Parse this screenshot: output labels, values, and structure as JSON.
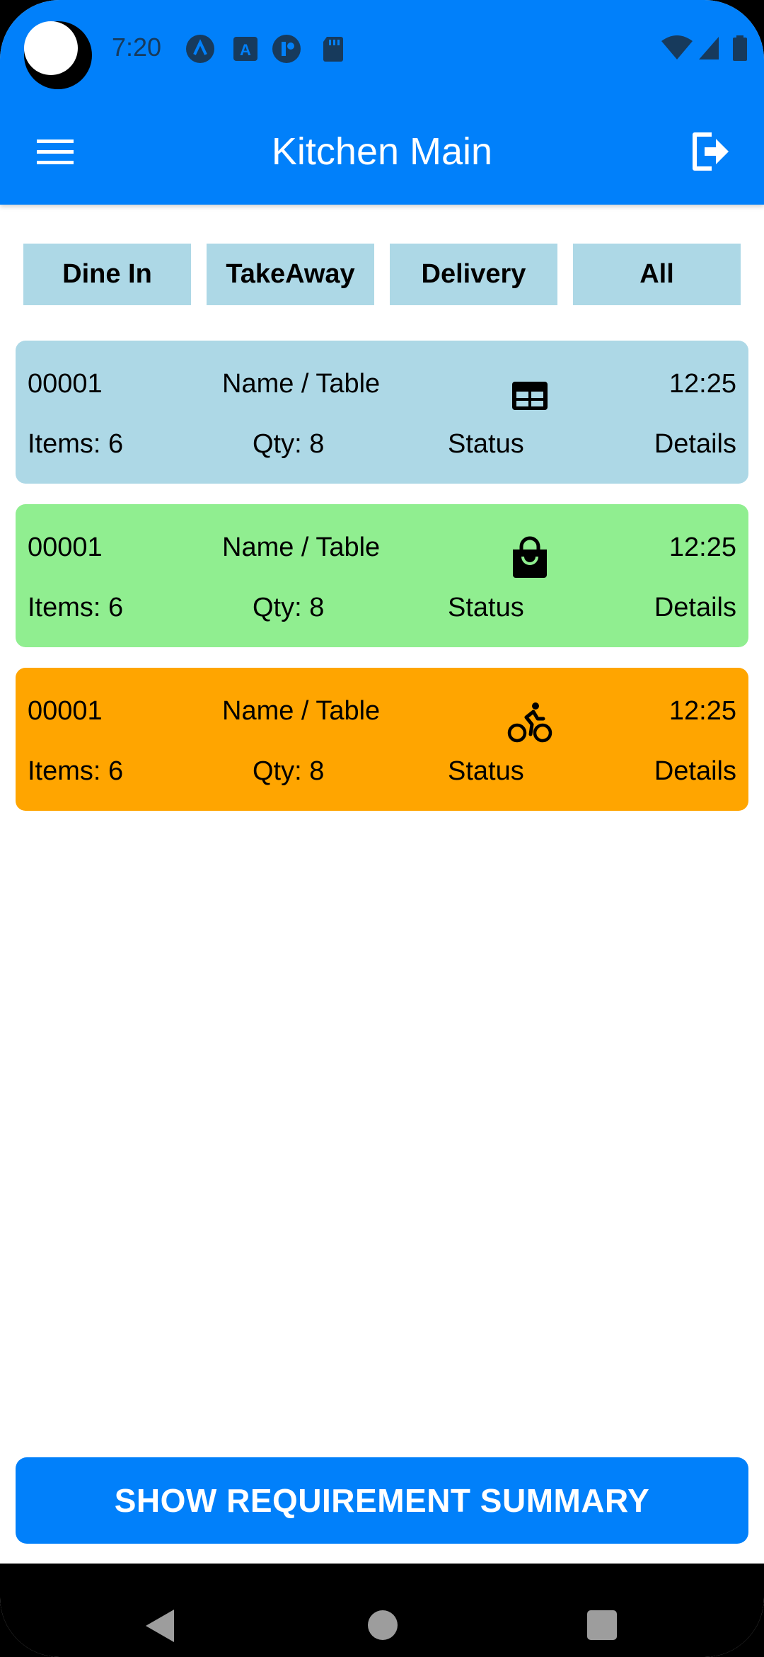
{
  "status_bar": {
    "time": "7:20",
    "icons_left": [
      "arc-icon",
      "text-a-icon",
      "circle-f-icon",
      "sd-card-icon"
    ],
    "icons_right": [
      "wifi-icon",
      "signal-icon",
      "battery-icon"
    ]
  },
  "app_bar": {
    "title": "Kitchen Main",
    "menu_icon": "hamburger-menu-icon",
    "logout_icon": "logout-icon"
  },
  "filters": {
    "dine_in": "Dine In",
    "takeaway": "TakeAway",
    "delivery": "Delivery",
    "all": "All",
    "background_color": "#add8e6"
  },
  "orders": [
    {
      "id": "00001",
      "name": "Name / Table",
      "type_icon": "table-icon",
      "time": "12:25",
      "items": "Items: 6",
      "qty": "Qty: 8",
      "status": "Status",
      "details": "Details",
      "color": "#add8e6"
    },
    {
      "id": "00001",
      "name": "Name / Table",
      "type_icon": "shopping-bag-icon",
      "time": "12:25",
      "items": "Items: 6",
      "qty": "Qty: 8",
      "status": "Status",
      "details": "Details",
      "color": "#90ee90"
    },
    {
      "id": "00001",
      "name": "Name / Table",
      "type_icon": "bicycle-rider-icon",
      "time": "12:25",
      "items": "Items: 6",
      "qty": "Qty: 8",
      "status": "Status",
      "details": "Details",
      "color": "#ffa500"
    }
  ],
  "summary_button": {
    "label": "SHOW REQUIREMENT SUMMARY",
    "color": "#0180fa"
  },
  "theme": {
    "primary": "#0180fa",
    "text_on_primary": "#ffffff"
  },
  "nav_bar": {
    "icons": [
      "back-icon",
      "home-icon",
      "recents-icon"
    ]
  }
}
